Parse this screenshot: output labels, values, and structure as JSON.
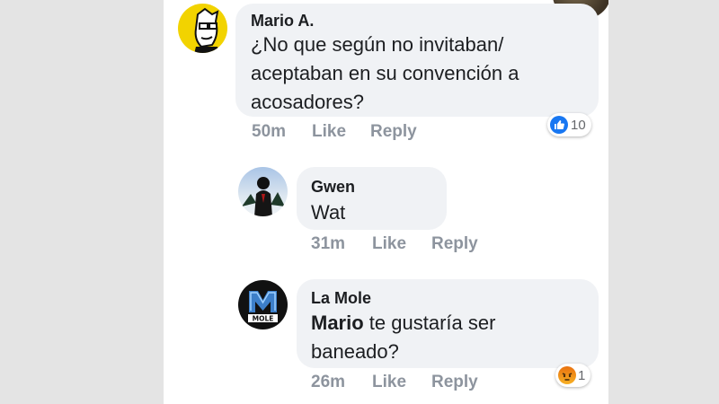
{
  "comments": [
    {
      "author": "Mario A.",
      "lines": [
        "¿No que según no invitaban/",
        "aceptaban en su convención a",
        "acosadores?"
      ],
      "time": "50m",
      "like_label": "Like",
      "reply_label": "Reply",
      "reaction": {
        "icon": "like-icon",
        "color": "#1877f2",
        "count": "10"
      }
    },
    {
      "author": "Gwen",
      "lines": [
        "Wat"
      ],
      "time": "31m",
      "like_label": "Like",
      "reply_label": "Reply"
    },
    {
      "author": "La Mole",
      "mention": "Mario",
      "line1_rest": " te gustaría ser",
      "line2": "baneado?",
      "time": "26m",
      "like_label": "Like",
      "reply_label": "Reply",
      "reaction": {
        "icon": "angry-icon",
        "color": "#e9710f",
        "count": "1"
      },
      "avatar_logo_text": "LA MOLE"
    }
  ]
}
